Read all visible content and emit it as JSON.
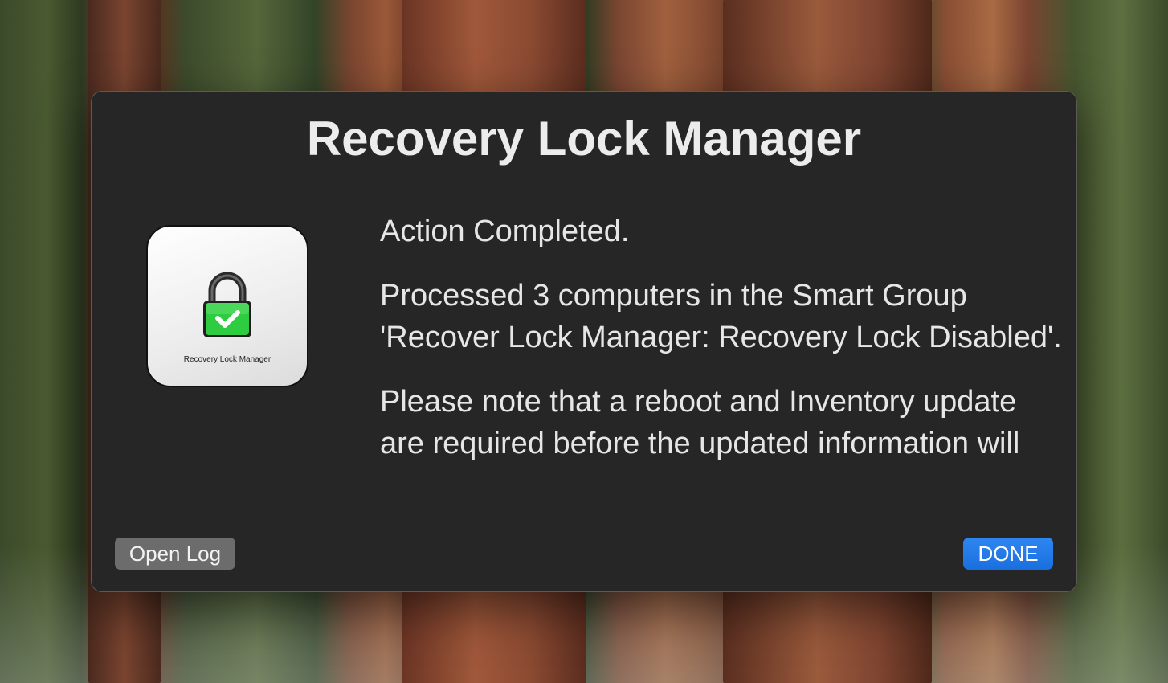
{
  "dialog": {
    "title": "Recovery Lock Manager",
    "icon": {
      "name": "padlock-checkmark-icon",
      "caption": "Recovery Lock Manager",
      "lock_color": "#2ecc40"
    },
    "messages": [
      "Action Completed.",
      "Processed 3 computers in the Smart Group 'Recover Lock Manager: Recovery Lock Disabled'.",
      "Please note that a reboot and Inventory update are required before the updated information will"
    ],
    "buttons": {
      "open_log": "Open Log",
      "done": "DONE"
    },
    "colors": {
      "background": "#262626",
      "primary_button": "#1a6fe0",
      "secondary_button": "#6c6c6c"
    }
  }
}
